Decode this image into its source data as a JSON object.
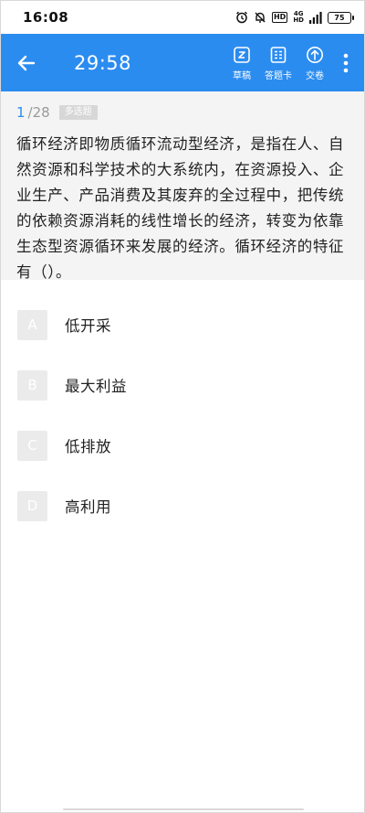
{
  "status_bar": {
    "time": "16:08",
    "hd_label": "HD",
    "network_top": "4G",
    "network_bottom": "HD",
    "battery_level": "75",
    "icons": [
      "alarm-icon",
      "mute-bell-icon",
      "hd-icon",
      "signal-icon",
      "battery-icon"
    ]
  },
  "app_bar": {
    "background_color": "#2b8cf0",
    "timer": "29:58",
    "actions": [
      {
        "label": "草稿",
        "icon": "draft-icon"
      },
      {
        "label": "答题卡",
        "icon": "answer-sheet-icon"
      },
      {
        "label": "交卷",
        "icon": "submit-icon"
      }
    ],
    "back_icon": "back-arrow-icon",
    "more_icon": "more-vertical-icon"
  },
  "question": {
    "index": "1",
    "total": "/28",
    "type": "多选题",
    "text": "循环经济即物质循环流动型经济，是指在人、自然资源和科学技术的大系统内，在资源投入、企业生产、产品消费及其废弃的全过程中，把传统的依赖资源消耗的线性增长的经济，转变为依靠生态型资源循环来发展的经济。循环经济的特征有（）。"
  },
  "options": [
    {
      "letter": "A",
      "text": "低开采"
    },
    {
      "letter": "B",
      "text": "最大利益"
    },
    {
      "letter": "C",
      "text": "低排放"
    },
    {
      "letter": "D",
      "text": "高利用"
    }
  ]
}
